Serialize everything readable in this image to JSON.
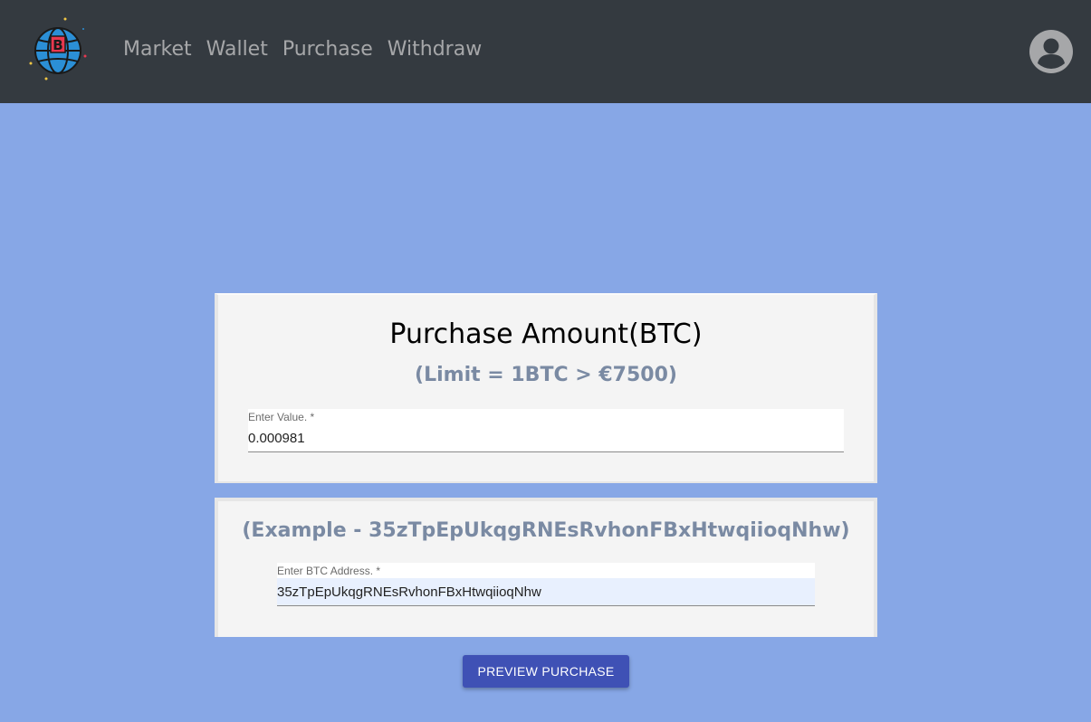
{
  "nav": {
    "links": [
      "Market",
      "Wallet",
      "Purchase",
      "Withdraw"
    ],
    "logo_icon": "bitcoin-globe-icon",
    "avatar_icon": "account-circle-icon",
    "colors": {
      "bar": "#343a40",
      "link": "#a6a7a9"
    }
  },
  "purchase_card": {
    "title": "Purchase Amount(BTC)",
    "limit": "(Limit = 1BTC > €7500)",
    "value_label": "Enter Value. *",
    "value": "0.000981"
  },
  "address_card": {
    "example": "(Example - 35zTpEpUkqgRNEsRvhonFBxHtwqiioqNhw)",
    "address_label": "Enter BTC Address. *",
    "address": "35zTpEpUkqgRNEsRvhonFBxHtwqiioqNhw"
  },
  "actions": {
    "preview_label": "PREVIEW PURCHASE",
    "button_color": "#3f51b5"
  },
  "theme": {
    "background": "#87a7e6"
  }
}
